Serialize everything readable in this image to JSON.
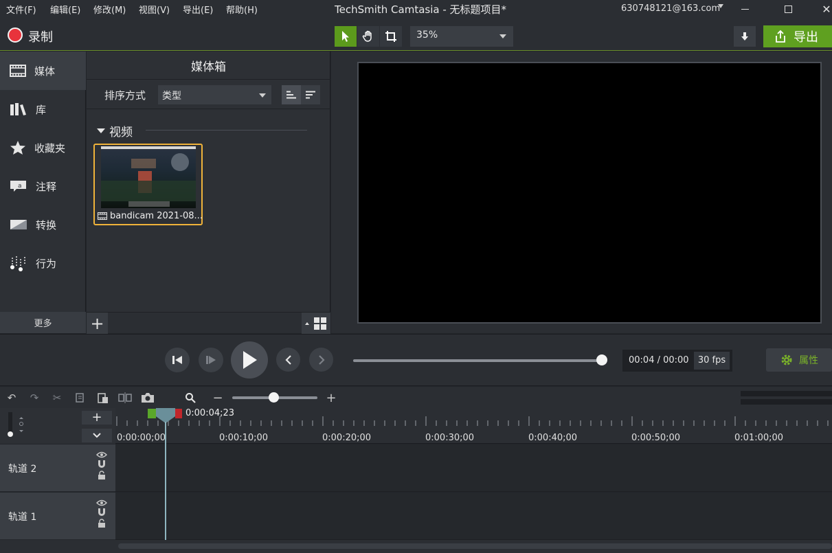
{
  "menu": {
    "items": [
      "文件(F)",
      "编辑(E)",
      "修改(M)",
      "视图(V)",
      "导出(E)",
      "帮助(H)"
    ],
    "title": "TechSmith Camtasia - 无标题项目*",
    "account": "630748121@163.com"
  },
  "toolbar": {
    "record_label": "录制",
    "zoom_value": "35%",
    "export_label": "导出"
  },
  "sidebar": {
    "items": [
      {
        "label": "媒体",
        "icon": "film-icon"
      },
      {
        "label": "库",
        "icon": "library-icon"
      },
      {
        "label": "收藏夹",
        "icon": "star-icon"
      },
      {
        "label": "注释",
        "icon": "annotation-icon"
      },
      {
        "label": "转换",
        "icon": "transition-icon"
      },
      {
        "label": "行为",
        "icon": "behavior-icon"
      }
    ],
    "more_label": "更多"
  },
  "mediabin": {
    "title": "媒体箱",
    "sort_label": "排序方式",
    "sort_value": "类型",
    "group_label": "视频",
    "clip_name": "bandicam 2021-08..."
  },
  "player": {
    "time": "00:04 / 00:00",
    "fps": "30 fps",
    "props_label": "属性",
    "progress": 1.0
  },
  "timeline": {
    "playhead_time": "0:00:04;23",
    "ticks": [
      "0:00:00;00",
      "0:00:10;00",
      "0:00:20;00",
      "0:00:30;00",
      "0:00:40;00",
      "0:00:50;00",
      "0:01:00;00"
    ],
    "tracks": [
      "轨道 2",
      "轨道 1"
    ]
  },
  "colors": {
    "accent": "#5fa020",
    "record": "#e8333c",
    "selection": "#f0b33a"
  }
}
